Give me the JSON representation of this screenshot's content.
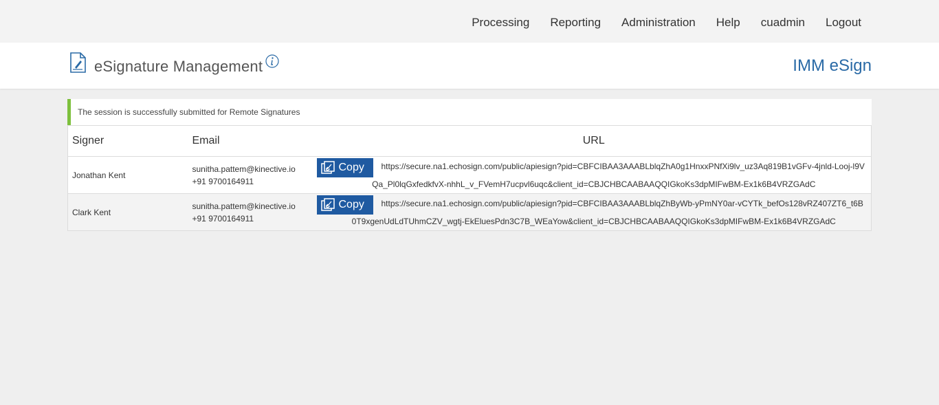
{
  "nav": {
    "items": [
      "Processing",
      "Reporting",
      "Administration",
      "Help",
      "cuadmin",
      "Logout"
    ]
  },
  "header": {
    "title": "eSignature Management",
    "brand": "IMM eSign"
  },
  "alert": {
    "message": "The session is successfully submitted for Remote Signatures"
  },
  "table": {
    "columns": {
      "signer": "Signer",
      "email": "Email",
      "url": "URL"
    },
    "copy_label": "Copy",
    "rows": [
      {
        "signer": "Jonathan Kent",
        "email": "sunitha.pattem@kinective.io",
        "phone": "+91 9700164911",
        "url": "https://secure.na1.echosign.com/public/apiesign?pid=CBFCIBAA3AAABLblqZhA0g1HnxxPNfXi9lv_uz3Aq819B1vGFv-4jnld-Looj-l9VQa_Pl0lqGxfedkfvX-nhhL_v_FVemH7ucpvl6uqc&client_id=CBJCHBCAABAAQQIGkoKs3dpMIFwBM-Ex1k6B4VRZGAdC"
      },
      {
        "signer": "Clark Kent",
        "email": "sunitha.pattem@kinective.io",
        "phone": "+91 9700164911",
        "url": "https://secure.na1.echosign.com/public/apiesign?pid=CBFCIBAA3AAABLblqZhByWb-yPmNY0ar-vCYTk_befOs128vRZ407ZT6_t6B0T9xgenUdLdTUhmCZV_wgtj-EkEluesPdn3C7B_WEaYow&client_id=CBJCHBCAABAAQQIGkoKs3dpMIFwBM-Ex1k6B4VRZGAdC"
      }
    ]
  },
  "colors": {
    "accent": "#1f5aa1",
    "brand": "#2a6aa6",
    "success": "#7dc03c"
  }
}
